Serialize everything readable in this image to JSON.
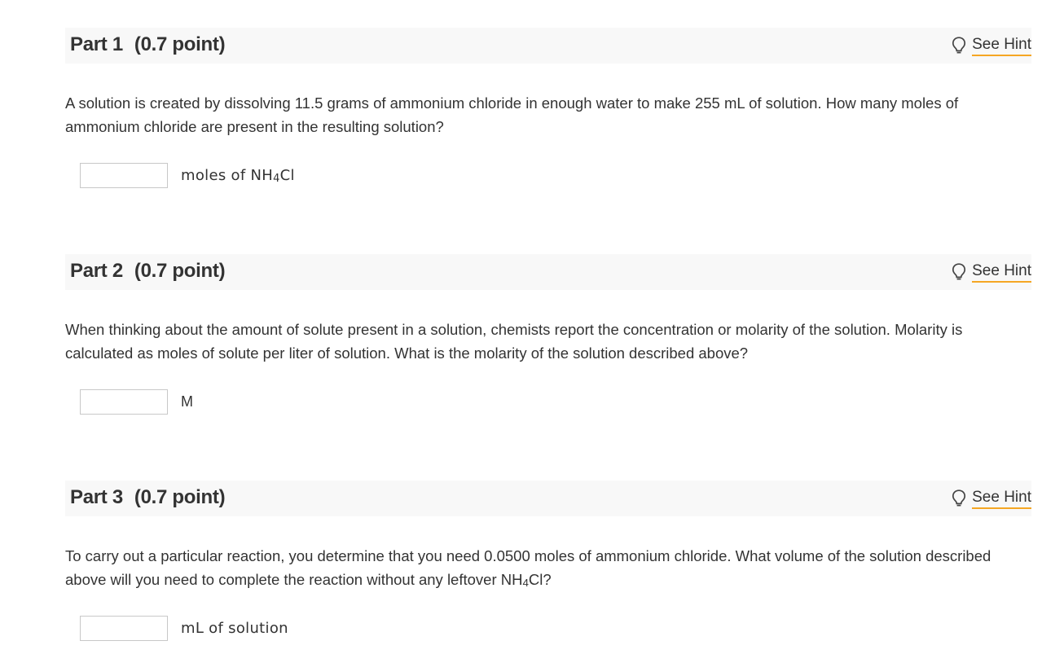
{
  "parts": [
    {
      "title": "Part 1",
      "points": "(0.7 point)",
      "hint_label": "See Hint",
      "question": "A solution is created by dissolving 11.5 grams of ammonium chloride in enough water to make 255 mL of solution. How many moles of ammonium chloride are present in the resulting solution?",
      "input_value": "",
      "unit_prefix": "moles of NH",
      "unit_sub": "4",
      "unit_suffix": "Cl"
    },
    {
      "title": "Part 2",
      "points": "(0.7 point)",
      "hint_label": "See Hint",
      "question": "When thinking about the amount of solute present in a solution, chemists report the concentration or molarity of the solution. Molarity is calculated as moles of solute per liter of solution. What is the molarity of the solution described above?",
      "input_value": "",
      "unit": "M"
    },
    {
      "title": "Part 3",
      "points": "(0.7 point)",
      "hint_label": "See Hint",
      "question_prefix": "To carry out a particular reaction, you determine that you need 0.0500 moles of ammonium chloride. What volume of the solution described above will you need to complete the reaction without any leftover NH",
      "question_sub": "4",
      "question_suffix": "Cl?",
      "input_value": "",
      "unit": "mL of solution"
    }
  ],
  "colors": {
    "header_bg": "#f8f8f8",
    "hint_underline": "#f5a623",
    "text": "#333333",
    "input_border": "#c8c8c8"
  },
  "icons": {
    "hint": "lightbulb-icon"
  }
}
